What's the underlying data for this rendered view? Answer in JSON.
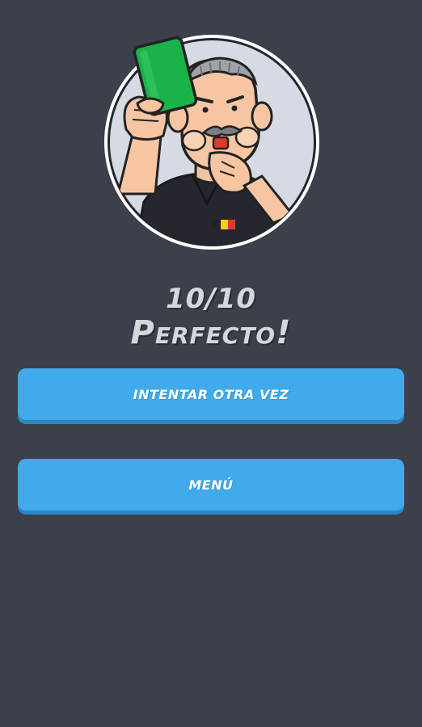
{
  "result": {
    "score": "10/10",
    "verdict": "Perfecto!"
  },
  "buttons": {
    "retry_label": "INTENTAR OTRA VEZ",
    "menu_label": "MENÚ"
  },
  "avatar": {
    "icon": "referee-green-card-illustration",
    "card_color": "#19b34a"
  },
  "colors": {
    "background": "#3b404b",
    "button": "#40aaea",
    "button_shadow": "#2d86c0",
    "text": "#d4d7dc"
  }
}
